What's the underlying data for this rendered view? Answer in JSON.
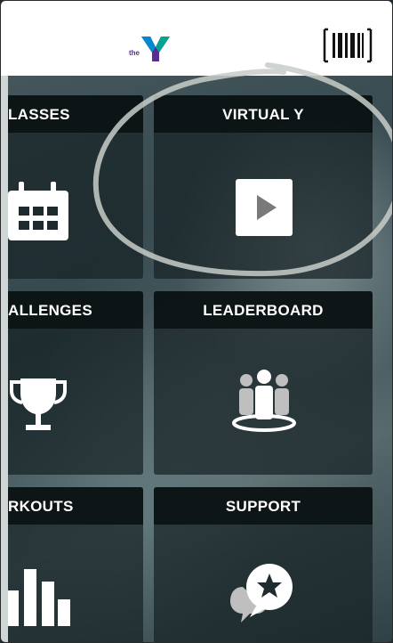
{
  "header": {
    "brand_text": "the",
    "logo": "ymca-logo",
    "barcode_icon": "barcode-scan-icon"
  },
  "tiles": [
    {
      "label": "LASSES",
      "icon": "calendar-icon"
    },
    {
      "label": "VIRTUAL Y",
      "icon": "play-icon"
    },
    {
      "label": "ALLENGES",
      "icon": "trophy-icon"
    },
    {
      "label": "LEADERBOARD",
      "icon": "people-group-icon"
    },
    {
      "label": "RKOUTS",
      "icon": "bar-chart-icon"
    },
    {
      "label": "SUPPORT",
      "icon": "chat-star-icon"
    }
  ],
  "colors": {
    "tile_head": "#0c1214",
    "accent_purple": "#5c2d91",
    "accent_blue": "#0089d0",
    "accent_green": "#01a490"
  }
}
